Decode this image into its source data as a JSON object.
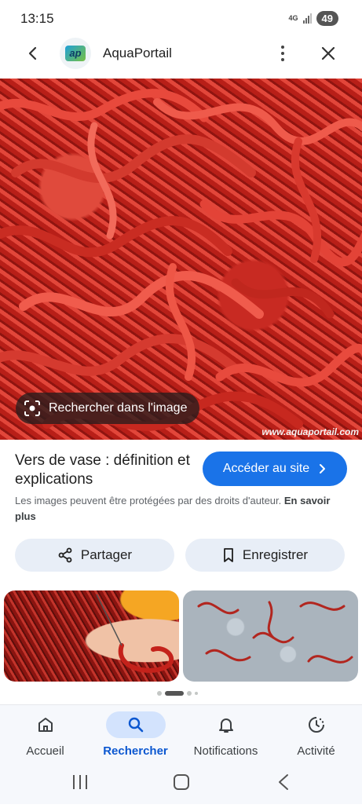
{
  "status_bar": {
    "time": "13:15",
    "network": "4G",
    "battery": "49"
  },
  "header": {
    "site_name": "AquaPortail",
    "logo_text": "ap"
  },
  "hero": {
    "lens_label": "Rechercher dans l'image",
    "watermark": "www.aquaportail.com"
  },
  "result": {
    "title": "Vers de vase : définition et explications",
    "visit_button": "Accéder au site",
    "copyright_text": "Les images peuvent être protégées par des droits d'auteur.",
    "learn_more": "En savoir plus"
  },
  "actions": {
    "share_label": "Partager",
    "save_label": "Enregistrer"
  },
  "bottom_nav": {
    "items": [
      {
        "label": "Accueil",
        "icon": "home-icon"
      },
      {
        "label": "Rechercher",
        "icon": "search-icon",
        "active": true
      },
      {
        "label": "Notifications",
        "icon": "bell-icon"
      },
      {
        "label": "Activité",
        "icon": "activity-icon"
      }
    ]
  },
  "colors": {
    "accent": "#1a73e8",
    "active_nav": "#0b57d0",
    "active_nav_bg": "#d3e3fd"
  }
}
